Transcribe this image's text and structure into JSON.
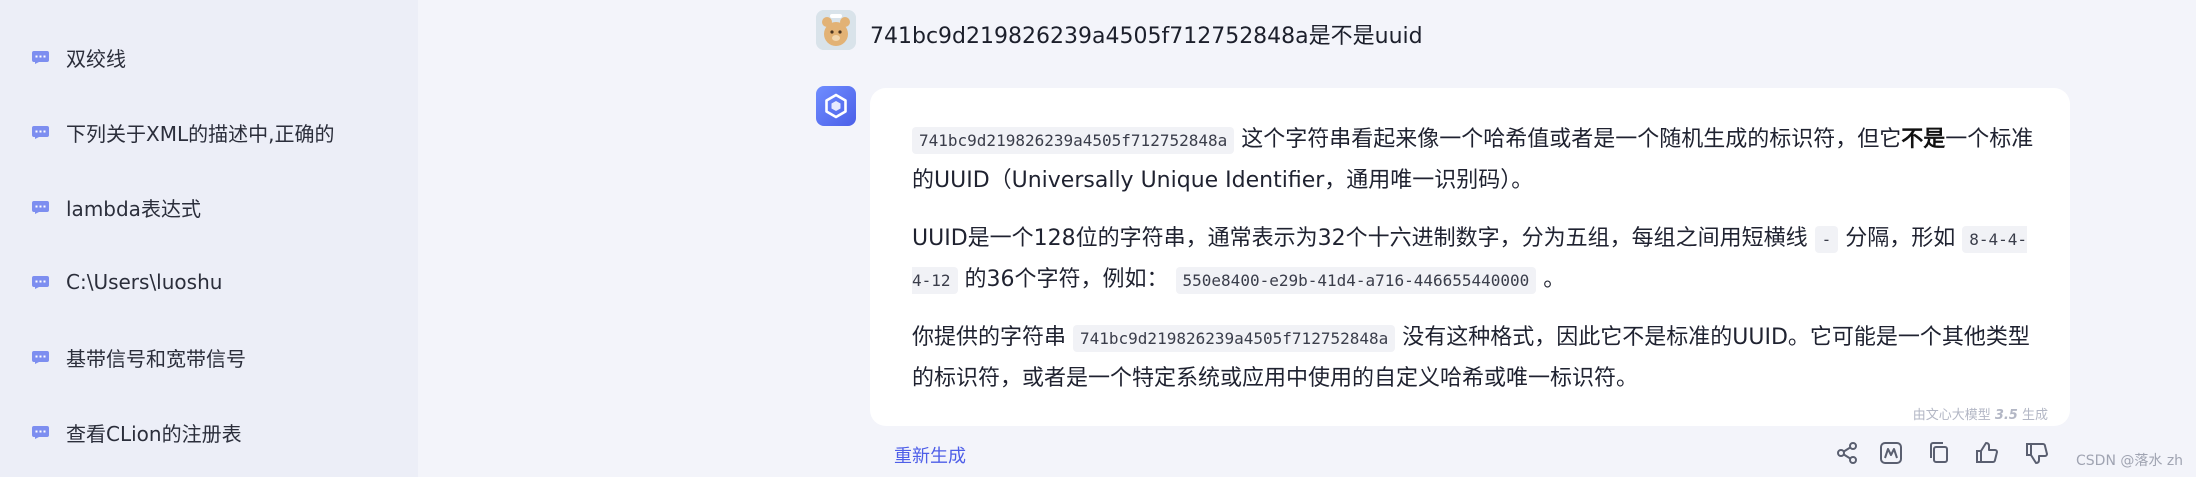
{
  "sidebar": {
    "items": [
      {
        "label": "双绞线"
      },
      {
        "label": "下列关于XML的描述中,正确的"
      },
      {
        "label": "lambda表达式"
      },
      {
        "label": "C:\\Users\\luoshu"
      },
      {
        "label": "基带信号和宽带信号"
      },
      {
        "label": "查看CLion的注册表"
      }
    ]
  },
  "question": {
    "text": "741bc9d219826239a4505f712752848a是不是uuid"
  },
  "answer": {
    "p1": {
      "code": "741bc9d219826239a4505f712752848a",
      "text_a": " 这个字符串看起来像一个哈希值或者是一个随机生成的标识符，但它",
      "bold": "不是",
      "text_b": "一个标准的UUID（Universally Unique Identifier，通用唯一识别码）。"
    },
    "p2": {
      "text_a": "UUID是一个128位的字符串，通常表示为32个十六进制数字，分为五组，每组之间用短横线 ",
      "code_a": "-",
      "text_b": " 分隔，形如 ",
      "code_b": "8-4-4-4-12",
      "text_c": " 的36个字符，例如： ",
      "code_c": "550e8400-e29b-41d4-a716-446655440000",
      "text_d": " 。"
    },
    "p3": {
      "text_a": "你提供的字符串 ",
      "code": "741bc9d219826239a4505f712752848a",
      "text_b": " 没有这种格式，因此它不是标准的UUID。它可能是一个其他类型的标识符，或者是一个特定系统或应用中使用的自定义哈希或唯一标识符。"
    },
    "generated_by": {
      "prefix": "由文心大模型 ",
      "version": "3.5",
      "suffix": " 生成"
    }
  },
  "footer": {
    "regenerate_label": "重新生成",
    "actions": [
      "share-icon",
      "mindmap-icon",
      "copy-icon",
      "thumbs-up-icon",
      "thumbs-down-icon"
    ],
    "credit": "CSDN @落水 zh"
  },
  "colors": {
    "accent": "#4e5ee8",
    "sidebar_bg": "#eceef7",
    "page_bg": "#f3f4fa"
  }
}
